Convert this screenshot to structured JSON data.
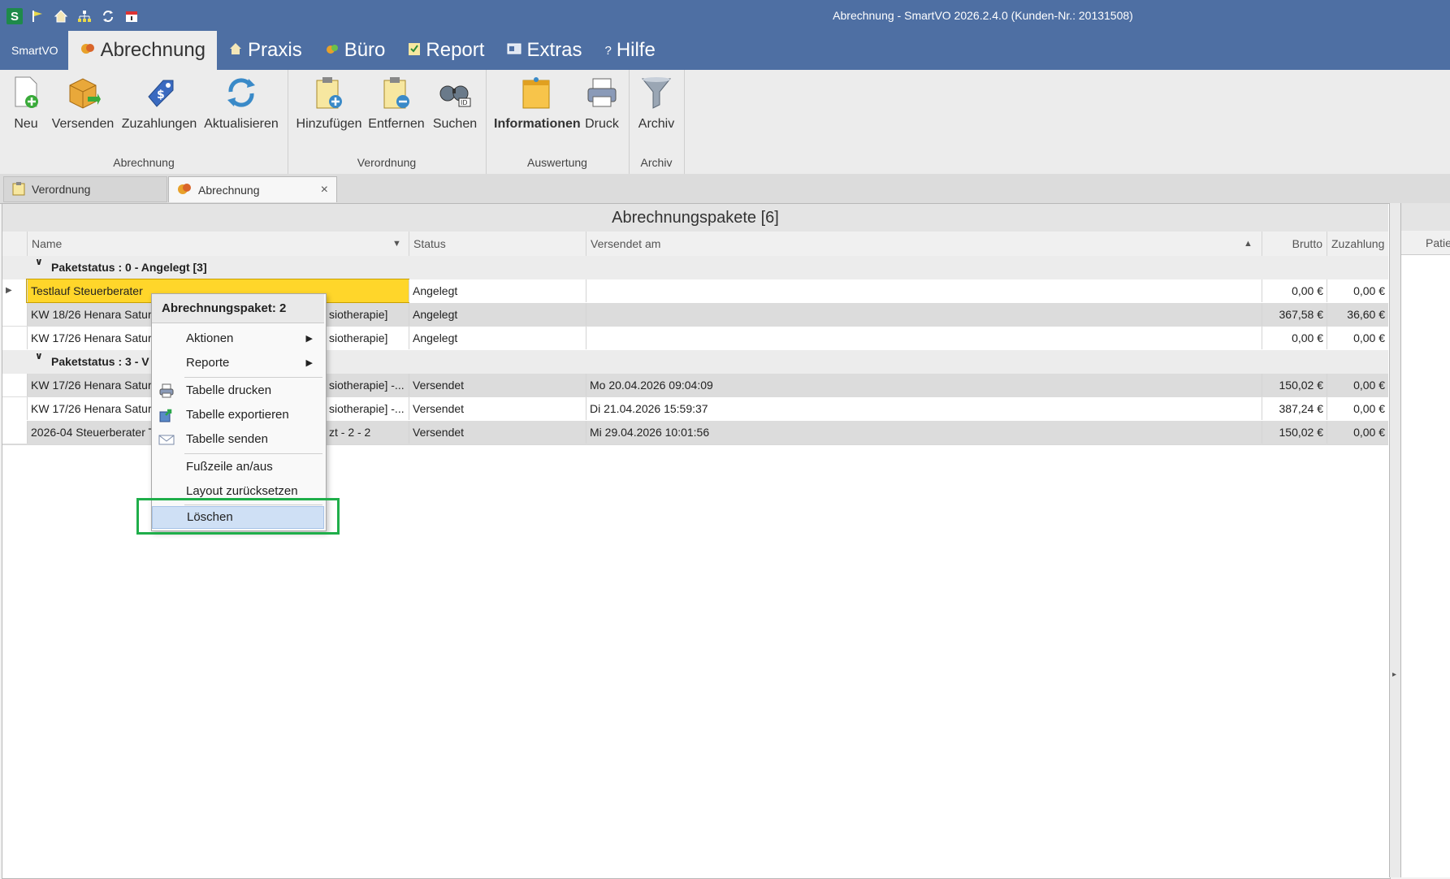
{
  "window": {
    "title": "Abrechnung - SmartVO 2026.2.4.0 (Kunden-Nr.: 20131508)",
    "quick_access_icons": [
      "app-s-icon",
      "flag-icon",
      "home-icon",
      "network-icon",
      "refresh-icon",
      "calendar-icon"
    ],
    "app_logo_letter": "S"
  },
  "menu": {
    "app": "SmartVO",
    "items": [
      {
        "label": "Abrechnung",
        "icon": "billing-icon"
      },
      {
        "label": "Praxis",
        "icon": "house-icon"
      },
      {
        "label": "Büro",
        "icon": "office-icon"
      },
      {
        "label": "Report",
        "icon": "report-icon"
      },
      {
        "label": "Extras",
        "icon": "extras-icon"
      },
      {
        "label": "Hilfe",
        "icon": "help-icon"
      }
    ]
  },
  "ribbon": {
    "groups": [
      {
        "label": "Abrechnung",
        "buttons": [
          "Neu",
          "Versenden",
          "Zuzahlungen",
          "Aktualisieren"
        ]
      },
      {
        "label": "Verordnung",
        "buttons": [
          "Hinzufügen",
          "Entfernen",
          "Suchen"
        ]
      },
      {
        "label": "Auswertung",
        "buttons": [
          "Informationen",
          "Druck"
        ]
      },
      {
        "label": "Archiv",
        "buttons": [
          "Archiv"
        ]
      }
    ]
  },
  "tabs": [
    {
      "label": "Verordnung",
      "active": false
    },
    {
      "label": "Abrechnung",
      "active": true,
      "close": "×"
    }
  ],
  "grid": {
    "caption": "Abrechnungspakete [6]",
    "columns": [
      "Name",
      "Status",
      "Versendet am",
      "Brutto",
      "Zuzahlung",
      "Patie"
    ],
    "groups": [
      {
        "label": "Paketstatus : 0 - Angelegt [3]",
        "rows": [
          {
            "name": "Testlauf Steuerberater",
            "status": "Angelegt",
            "sent": "",
            "brutto": "0,00 €",
            "zuzahlung": "0,00 €"
          },
          {
            "name": "KW 18/26  Henara Saturi",
            "name_tail": "siotherapie]",
            "status": "Angelegt",
            "sent": "",
            "brutto": "367,58 €",
            "zuzahlung": "36,60 €"
          },
          {
            "name": "KW 17/26  Henara Saturi",
            "name_tail": "siotherapie]",
            "status": "Angelegt",
            "sent": "",
            "brutto": "0,00 €",
            "zuzahlung": "0,00 €"
          }
        ]
      },
      {
        "label": "Paketstatus : 3 - V",
        "rows": [
          {
            "name": "KW 17/26  Henara Saturi",
            "name_tail": "siotherapie] -...",
            "status": "Versendet",
            "sent": "Mo 20.04.2026 09:04:09",
            "brutto": "150,02 €",
            "zuzahlung": "0,00 €"
          },
          {
            "name": "KW 17/26  Henara Saturi",
            "name_tail": "siotherapie] -...",
            "status": "Versendet",
            "sent": "Di 21.04.2026 15:59:37",
            "brutto": "387,24 €",
            "zuzahlung": "0,00 €"
          },
          {
            "name": "2026-04 Steuerberater T",
            "name_tail": "zt - 2 - 2",
            "status": "Versendet",
            "sent": "Mi 29.04.2026 10:01:56",
            "brutto": "150,02 €",
            "zuzahlung": "0,00 €"
          }
        ]
      }
    ]
  },
  "context_menu": {
    "title": "Abrechnungspaket: 2",
    "items": [
      {
        "label": "Aktionen",
        "submenu": true
      },
      {
        "label": "Reporte",
        "submenu": true
      },
      {
        "label": "Tabelle drucken",
        "icon": "print-icon"
      },
      {
        "label": "Tabelle exportieren",
        "icon": "export-icon"
      },
      {
        "label": "Tabelle senden",
        "icon": "mail-icon"
      },
      {
        "label": "Fußzeile an/aus"
      },
      {
        "label": "Layout zurücksetzen"
      },
      {
        "label": "Löschen",
        "highlighted": true
      }
    ]
  },
  "colors": {
    "titlebar": "#4e6fa3",
    "selected_cell": "#ffd62a",
    "highlight_box": "#1fae4a",
    "menu_hover": "#cfe0f5"
  }
}
